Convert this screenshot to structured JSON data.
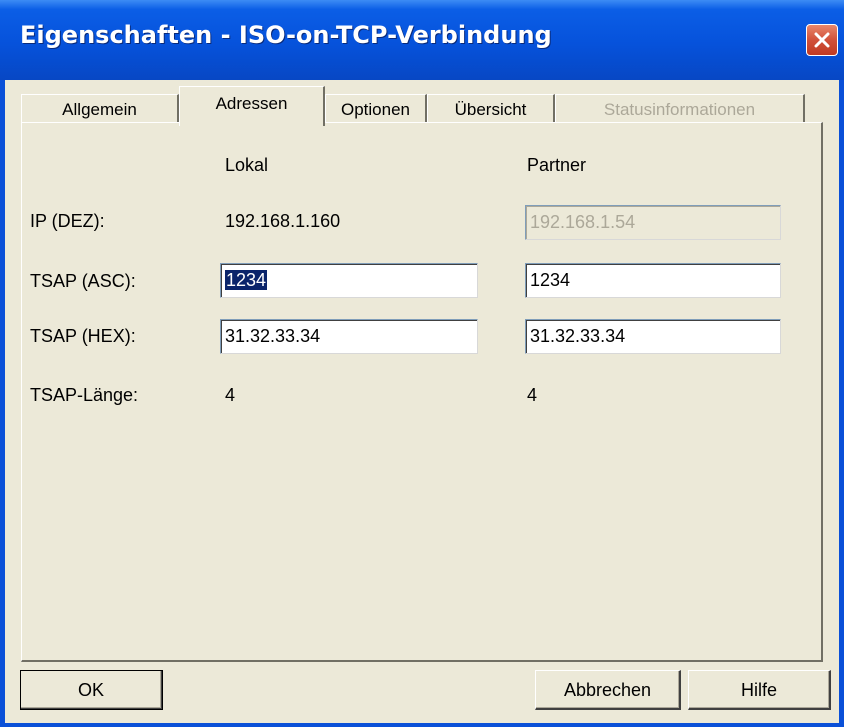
{
  "window": {
    "title": "Eigenschaften - ISO-on-TCP-Verbindung",
    "close_icon": "close-icon"
  },
  "tabs": [
    {
      "label": "Allgemein",
      "state": "normal"
    },
    {
      "label": "Adressen",
      "state": "active"
    },
    {
      "label": "Optionen",
      "state": "normal"
    },
    {
      "label": "Übersicht",
      "state": "normal"
    },
    {
      "label": "Statusinformationen",
      "state": "disabled"
    }
  ],
  "columns": {
    "local": "Lokal",
    "partner": "Partner"
  },
  "rows": {
    "ip": {
      "label": "IP (DEZ):",
      "local": "192.168.1.160",
      "partner": "192.168.1.54"
    },
    "tsap_asc": {
      "label": "TSAP (ASC):",
      "local": "1234",
      "partner": "1234"
    },
    "tsap_hex": {
      "label": "TSAP (HEX):",
      "local": "31.32.33.34",
      "partner": "31.32.33.34"
    },
    "tsap_len": {
      "label": "TSAP-Länge:",
      "local": "4",
      "partner": "4"
    }
  },
  "buttons": {
    "ok": "OK",
    "cancel": "Abbrechen",
    "help": "Hilfe"
  }
}
